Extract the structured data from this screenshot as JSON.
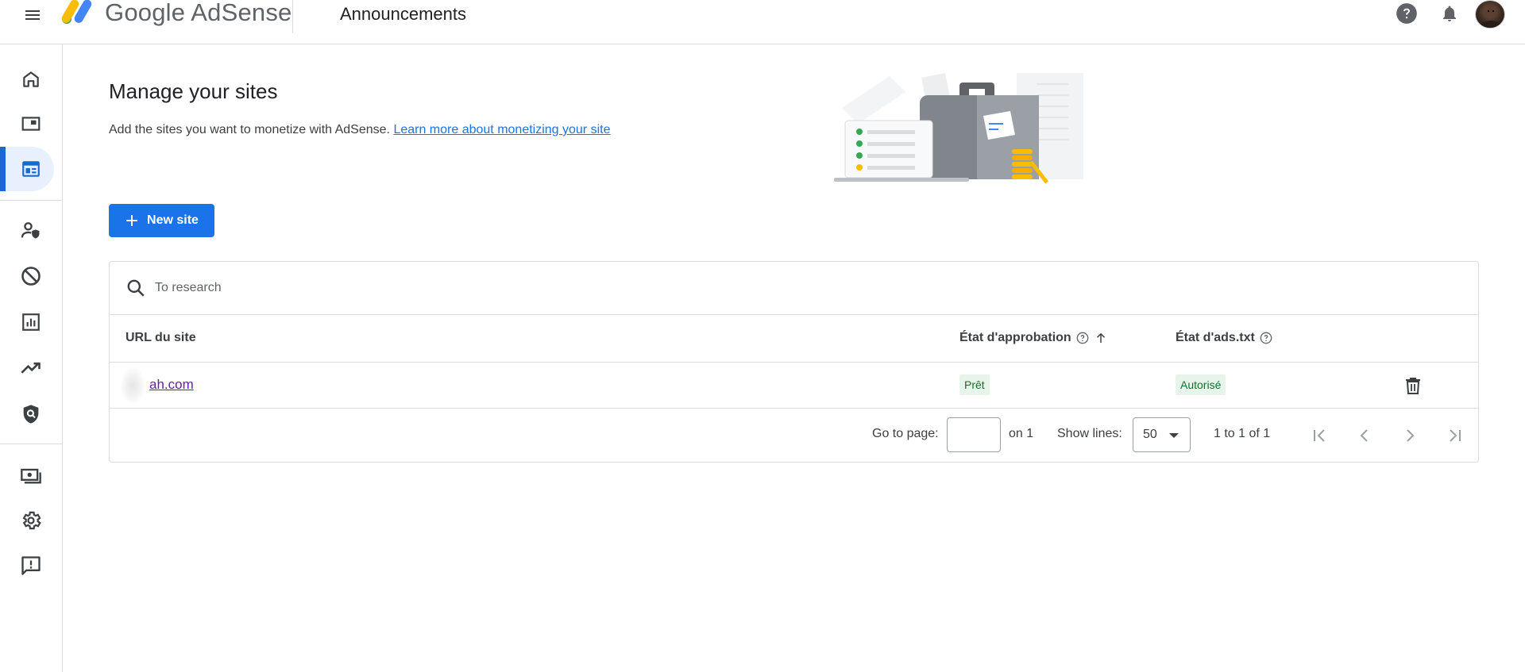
{
  "header": {
    "brand_name": "Google AdSense",
    "page_title": "Announcements",
    "icons": [
      "menu-icon",
      "help-icon",
      "notifications-icon",
      "avatar"
    ]
  },
  "sidebar": {
    "items": [
      {
        "name": "home-icon",
        "active": false
      },
      {
        "name": "ads-icon",
        "active": false
      },
      {
        "name": "sites-icon",
        "active": true
      },
      {
        "name": "privacy-messaging-icon",
        "active": false
      },
      {
        "name": "block-icon",
        "active": false
      },
      {
        "name": "reports-icon",
        "active": false
      },
      {
        "name": "optimization-icon",
        "active": false
      },
      {
        "name": "policy-center-icon",
        "active": false
      },
      {
        "name": "payments-icon",
        "active": false
      },
      {
        "name": "settings-icon",
        "active": false
      },
      {
        "name": "feedback-icon",
        "active": false
      }
    ]
  },
  "main": {
    "title": "Manage your sites",
    "description": "Add the sites you want to monetize with AdSense.",
    "learn_more_link": "Learn more about monetizing your site",
    "new_site_button": "New site"
  },
  "table": {
    "search_placeholder": "To research",
    "columns": {
      "url": "URL du site",
      "approval": "État d'approbation",
      "ads_txt": "État d'ads.txt"
    },
    "rows": [
      {
        "url": "ah.com",
        "approval": "Prêt",
        "ads_txt": "Autorisé"
      }
    ],
    "pagination": {
      "go_to_page": "Go to page:",
      "page_input_value": "",
      "on_total": "on 1",
      "show_lines": "Show lines:",
      "lines_value": "50",
      "range": "1 to 1 of 1"
    }
  },
  "colors": {
    "primary": "#1a73e8",
    "active_nav": "#1967d2",
    "badge_bg": "#e6f4ea",
    "badge_text": "#137333",
    "visited_link": "#681da8"
  }
}
